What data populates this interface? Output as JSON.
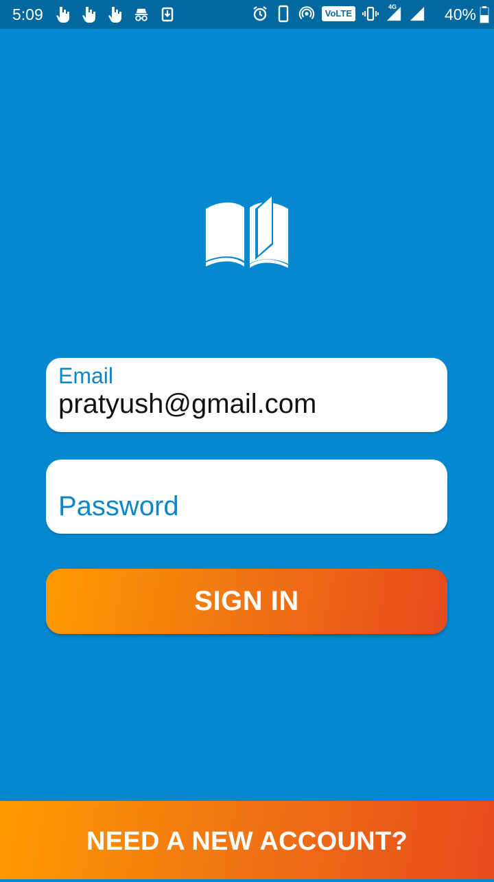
{
  "status_bar": {
    "time": "5:09",
    "left_icons": [
      "dollar-hand-icon",
      "dollar-hand-icon",
      "dollar-hand-icon",
      "incognito-icon",
      "download-icon"
    ],
    "right_icons": [
      "alarm-icon",
      "phone-icon",
      "hotspot-icon",
      "volte-badge",
      "vibrate-icon",
      "signal-icon",
      "signal-icon"
    ],
    "volte_label": "VoLTE",
    "network_label": "4G",
    "battery_percent": "40%"
  },
  "logo": {
    "icon": "open-book-icon"
  },
  "form": {
    "email": {
      "label": "Email",
      "value": "pratyush@gmail.com"
    },
    "password": {
      "placeholder": "Password"
    },
    "signin_label": "SIGN IN"
  },
  "footer": {
    "new_account_label": "NEED A NEW ACCOUNT?"
  },
  "colors": {
    "background": "#0388D1",
    "status_bar": "#02689F",
    "field_label": "#0C86C8",
    "button_gradient_start": "#FF9A00",
    "button_gradient_end": "#E64A1C"
  }
}
